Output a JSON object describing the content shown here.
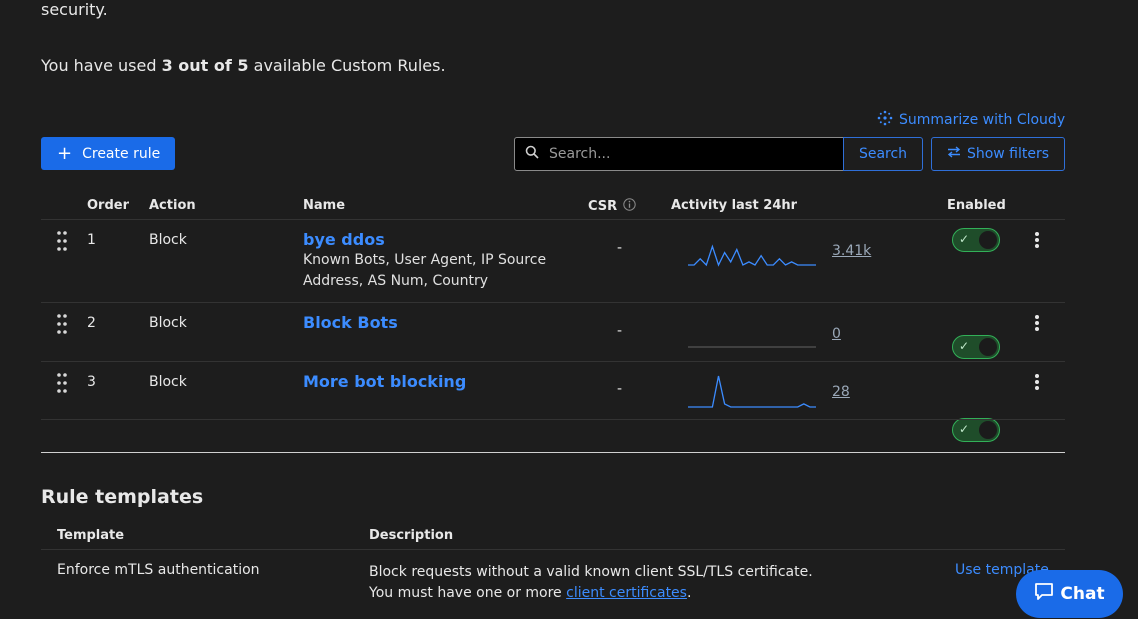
{
  "intro": {
    "trailing_text": "security."
  },
  "usage": {
    "prefix": "You have used ",
    "amount": "3 out of 5",
    "suffix": " available Custom Rules."
  },
  "toolbar": {
    "cloudy_label": "Summarize with Cloudy",
    "create_label": "Create rule",
    "search_placeholder": "Search...",
    "search_button": "Search",
    "filters_button": "Show filters"
  },
  "rules_table": {
    "headers": {
      "order": "Order",
      "action": "Action",
      "name": "Name",
      "csr": "CSR",
      "activity": "Activity last 24hr",
      "enabled": "Enabled"
    },
    "rows": [
      {
        "order": "1",
        "action": "Block",
        "name": "bye ddos",
        "subtitle": "Known Bots, User Agent, IP Source Address, AS Num, Country",
        "csr": "-",
        "count": "3.41k",
        "enabled": true,
        "sparkline": [
          0,
          0,
          2,
          0,
          6,
          0,
          4,
          1,
          5,
          0,
          1,
          0,
          3,
          0,
          0,
          2,
          0,
          1,
          0,
          0,
          0,
          0
        ]
      },
      {
        "order": "2",
        "action": "Block",
        "name": "Block Bots",
        "subtitle": "",
        "csr": "-",
        "count": "0",
        "enabled": true,
        "sparkline": [
          0,
          0,
          0,
          0,
          0,
          0,
          0,
          0,
          0,
          0,
          0,
          0,
          0,
          0,
          0,
          0,
          0,
          0,
          0,
          0,
          0,
          0
        ]
      },
      {
        "order": "3",
        "action": "Block",
        "name": "More bot blocking",
        "subtitle": "",
        "csr": "-",
        "count": "28",
        "enabled": true,
        "sparkline": [
          0,
          0,
          0,
          0,
          0,
          10,
          1,
          0,
          0,
          0,
          0,
          0,
          0,
          0,
          0,
          0,
          0,
          0,
          0,
          1,
          0,
          0
        ]
      }
    ]
  },
  "templates": {
    "title": "Rule templates",
    "headers": {
      "template": "Template",
      "description": "Description"
    },
    "rows": [
      {
        "template": "Enforce mTLS authentication",
        "desc_line1": "Block requests without a valid known client SSL/TLS certificate.",
        "desc_line2_prefix": "You must have one or more ",
        "desc_link": "client certificates",
        "desc_line2_suffix": ".",
        "action": "Use template"
      }
    ]
  },
  "chat": {
    "label": "Chat"
  },
  "colors": {
    "accent": "#1a6be8",
    "link": "#3c8cff",
    "toggle_on": "#32b058",
    "background": "#1d1d1d"
  }
}
